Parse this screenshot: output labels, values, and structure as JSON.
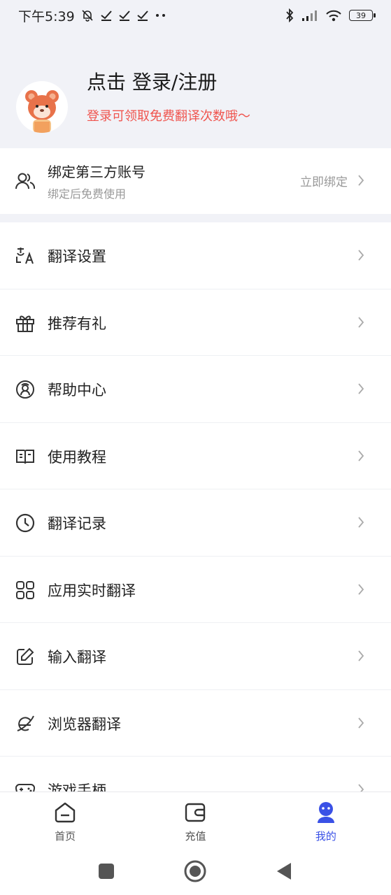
{
  "status": {
    "time": "下午5:39",
    "battery": "39"
  },
  "header": {
    "login_title": "点击 登录/注册",
    "login_sub": "登录可领取免费翻译次数哦～"
  },
  "bind": {
    "title": "绑定第三方账号",
    "subtitle": "绑定后免费使用",
    "action": "立即绑定",
    "icon": "users-icon"
  },
  "menu": [
    {
      "label": "翻译设置",
      "icon": "translate-icon"
    },
    {
      "label": "推荐有礼",
      "icon": "gift-icon"
    },
    {
      "label": "帮助中心",
      "icon": "help-support-icon"
    },
    {
      "label": "使用教程",
      "icon": "book-icon"
    },
    {
      "label": "翻译记录",
      "icon": "clock-icon"
    },
    {
      "label": "应用实时翻译",
      "icon": "apps-grid-icon"
    },
    {
      "label": "输入翻译",
      "icon": "edit-icon"
    },
    {
      "label": "浏览器翻译",
      "icon": "browser-icon"
    },
    {
      "label": "游戏手柄",
      "icon": "gamepad-icon"
    }
  ],
  "tabs": [
    {
      "label": "首页",
      "icon": "home-icon",
      "active": false
    },
    {
      "label": "充值",
      "icon": "wallet-icon",
      "active": false
    },
    {
      "label": "我的",
      "icon": "profile-icon",
      "active": true
    }
  ],
  "colors": {
    "accent": "#3a51e6",
    "promo": "#f0554f",
    "header_bg": "#f1f2f7"
  }
}
